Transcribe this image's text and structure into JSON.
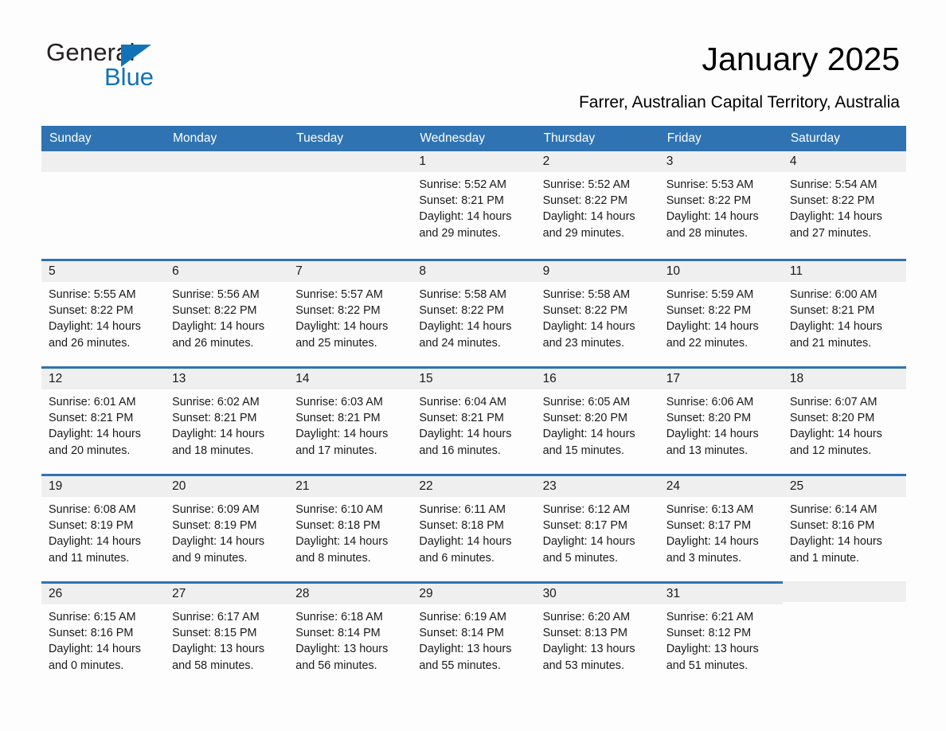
{
  "logo": {
    "word_one": "General",
    "word_two": "Blue",
    "triangle_color": "#1272b6",
    "text_color": "#231f20"
  },
  "header": {
    "title": "January 2025",
    "subtitle": "Farrer, Australian Capital Territory, Australia"
  },
  "theme": {
    "header_blue": "#2f73b2",
    "daynum_band": "#efefef",
    "page_background": "#fdfdfd",
    "text": "#1a1a1a"
  },
  "calendar": {
    "weekday_headers": [
      "Sunday",
      "Monday",
      "Tuesday",
      "Wednesday",
      "Thursday",
      "Friday",
      "Saturday"
    ],
    "weeks": [
      [
        {
          "day": "",
          "sunrise": "",
          "sunset": "",
          "daylight": "",
          "state": "empty"
        },
        {
          "day": "",
          "sunrise": "",
          "sunset": "",
          "daylight": "",
          "state": "empty"
        },
        {
          "day": "",
          "sunrise": "",
          "sunset": "",
          "daylight": "",
          "state": "empty"
        },
        {
          "day": "1",
          "sunrise": "Sunrise: 5:52 AM",
          "sunset": "Sunset: 8:21 PM",
          "daylight": "Daylight: 14 hours and 29 minutes.",
          "state": "filled"
        },
        {
          "day": "2",
          "sunrise": "Sunrise: 5:52 AM",
          "sunset": "Sunset: 8:22 PM",
          "daylight": "Daylight: 14 hours and 29 minutes.",
          "state": "filled"
        },
        {
          "day": "3",
          "sunrise": "Sunrise: 5:53 AM",
          "sunset": "Sunset: 8:22 PM",
          "daylight": "Daylight: 14 hours and 28 minutes.",
          "state": "filled"
        },
        {
          "day": "4",
          "sunrise": "Sunrise: 5:54 AM",
          "sunset": "Sunset: 8:22 PM",
          "daylight": "Daylight: 14 hours and 27 minutes.",
          "state": "filled"
        }
      ],
      [
        {
          "day": "5",
          "sunrise": "Sunrise: 5:55 AM",
          "sunset": "Sunset: 8:22 PM",
          "daylight": "Daylight: 14 hours and 26 minutes.",
          "state": "filled"
        },
        {
          "day": "6",
          "sunrise": "Sunrise: 5:56 AM",
          "sunset": "Sunset: 8:22 PM",
          "daylight": "Daylight: 14 hours and 26 minutes.",
          "state": "filled"
        },
        {
          "day": "7",
          "sunrise": "Sunrise: 5:57 AM",
          "sunset": "Sunset: 8:22 PM",
          "daylight": "Daylight: 14 hours and 25 minutes.",
          "state": "filled"
        },
        {
          "day": "8",
          "sunrise": "Sunrise: 5:58 AM",
          "sunset": "Sunset: 8:22 PM",
          "daylight": "Daylight: 14 hours and 24 minutes.",
          "state": "filled"
        },
        {
          "day": "9",
          "sunrise": "Sunrise: 5:58 AM",
          "sunset": "Sunset: 8:22 PM",
          "daylight": "Daylight: 14 hours and 23 minutes.",
          "state": "filled"
        },
        {
          "day": "10",
          "sunrise": "Sunrise: 5:59 AM",
          "sunset": "Sunset: 8:22 PM",
          "daylight": "Daylight: 14 hours and 22 minutes.",
          "state": "filled"
        },
        {
          "day": "11",
          "sunrise": "Sunrise: 6:00 AM",
          "sunset": "Sunset: 8:21 PM",
          "daylight": "Daylight: 14 hours and 21 minutes.",
          "state": "filled"
        }
      ],
      [
        {
          "day": "12",
          "sunrise": "Sunrise: 6:01 AM",
          "sunset": "Sunset: 8:21 PM",
          "daylight": "Daylight: 14 hours and 20 minutes.",
          "state": "filled"
        },
        {
          "day": "13",
          "sunrise": "Sunrise: 6:02 AM",
          "sunset": "Sunset: 8:21 PM",
          "daylight": "Daylight: 14 hours and 18 minutes.",
          "state": "filled"
        },
        {
          "day": "14",
          "sunrise": "Sunrise: 6:03 AM",
          "sunset": "Sunset: 8:21 PM",
          "daylight": "Daylight: 14 hours and 17 minutes.",
          "state": "filled"
        },
        {
          "day": "15",
          "sunrise": "Sunrise: 6:04 AM",
          "sunset": "Sunset: 8:21 PM",
          "daylight": "Daylight: 14 hours and 16 minutes.",
          "state": "filled"
        },
        {
          "day": "16",
          "sunrise": "Sunrise: 6:05 AM",
          "sunset": "Sunset: 8:20 PM",
          "daylight": "Daylight: 14 hours and 15 minutes.",
          "state": "filled"
        },
        {
          "day": "17",
          "sunrise": "Sunrise: 6:06 AM",
          "sunset": "Sunset: 8:20 PM",
          "daylight": "Daylight: 14 hours and 13 minutes.",
          "state": "filled"
        },
        {
          "day": "18",
          "sunrise": "Sunrise: 6:07 AM",
          "sunset": "Sunset: 8:20 PM",
          "daylight": "Daylight: 14 hours and 12 minutes.",
          "state": "filled"
        }
      ],
      [
        {
          "day": "19",
          "sunrise": "Sunrise: 6:08 AM",
          "sunset": "Sunset: 8:19 PM",
          "daylight": "Daylight: 14 hours and 11 minutes.",
          "state": "filled"
        },
        {
          "day": "20",
          "sunrise": "Sunrise: 6:09 AM",
          "sunset": "Sunset: 8:19 PM",
          "daylight": "Daylight: 14 hours and 9 minutes.",
          "state": "filled"
        },
        {
          "day": "21",
          "sunrise": "Sunrise: 6:10 AM",
          "sunset": "Sunset: 8:18 PM",
          "daylight": "Daylight: 14 hours and 8 minutes.",
          "state": "filled"
        },
        {
          "day": "22",
          "sunrise": "Sunrise: 6:11 AM",
          "sunset": "Sunset: 8:18 PM",
          "daylight": "Daylight: 14 hours and 6 minutes.",
          "state": "filled"
        },
        {
          "day": "23",
          "sunrise": "Sunrise: 6:12 AM",
          "sunset": "Sunset: 8:17 PM",
          "daylight": "Daylight: 14 hours and 5 minutes.",
          "state": "filled"
        },
        {
          "day": "24",
          "sunrise": "Sunrise: 6:13 AM",
          "sunset": "Sunset: 8:17 PM",
          "daylight": "Daylight: 14 hours and 3 minutes.",
          "state": "filled"
        },
        {
          "day": "25",
          "sunrise": "Sunrise: 6:14 AM",
          "sunset": "Sunset: 8:16 PM",
          "daylight": "Daylight: 14 hours and 1 minute.",
          "state": "filled"
        }
      ],
      [
        {
          "day": "26",
          "sunrise": "Sunrise: 6:15 AM",
          "sunset": "Sunset: 8:16 PM",
          "daylight": "Daylight: 14 hours and 0 minutes.",
          "state": "filled"
        },
        {
          "day": "27",
          "sunrise": "Sunrise: 6:17 AM",
          "sunset": "Sunset: 8:15 PM",
          "daylight": "Daylight: 13 hours and 58 minutes.",
          "state": "filled"
        },
        {
          "day": "28",
          "sunrise": "Sunrise: 6:18 AM",
          "sunset": "Sunset: 8:14 PM",
          "daylight": "Daylight: 13 hours and 56 minutes.",
          "state": "filled"
        },
        {
          "day": "29",
          "sunrise": "Sunrise: 6:19 AM",
          "sunset": "Sunset: 8:14 PM",
          "daylight": "Daylight: 13 hours and 55 minutes.",
          "state": "filled"
        },
        {
          "day": "30",
          "sunrise": "Sunrise: 6:20 AM",
          "sunset": "Sunset: 8:13 PM",
          "daylight": "Daylight: 13 hours and 53 minutes.",
          "state": "filled"
        },
        {
          "day": "31",
          "sunrise": "Sunrise: 6:21 AM",
          "sunset": "Sunset: 8:12 PM",
          "daylight": "Daylight: 13 hours and 51 minutes.",
          "state": "filled"
        },
        {
          "day": "",
          "sunrise": "",
          "sunset": "",
          "daylight": "",
          "state": "blank"
        }
      ]
    ]
  }
}
